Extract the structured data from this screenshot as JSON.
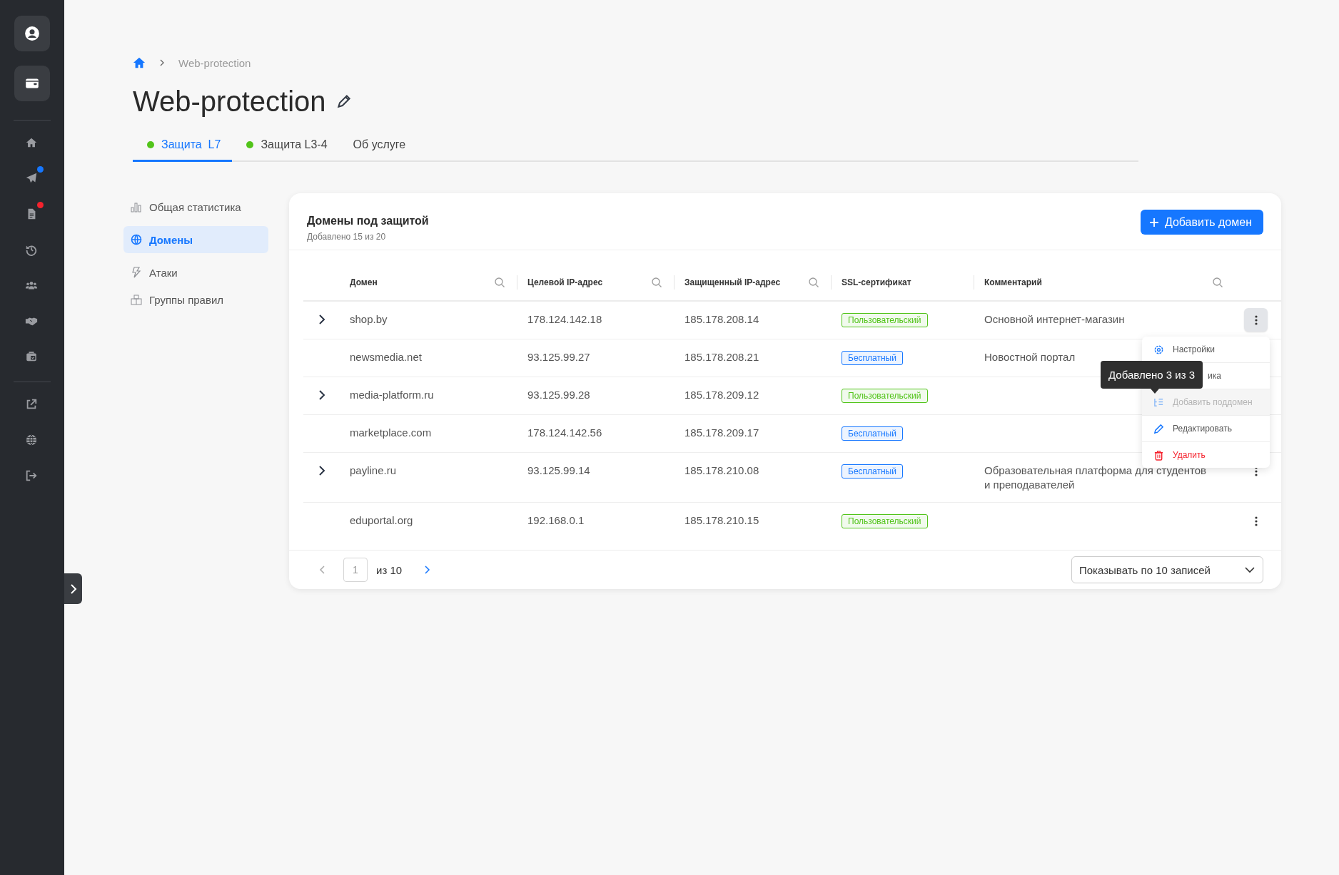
{
  "sidebar": {
    "top_items": [
      {
        "kind": "user"
      },
      {
        "kind": "wallet"
      }
    ],
    "items": [
      {
        "kind": "home"
      },
      {
        "kind": "plane",
        "color": "#1677ff"
      },
      {
        "kind": "doc",
        "color": "#f5222d"
      },
      {
        "kind": "history"
      },
      {
        "kind": "users"
      },
      {
        "kind": "handshake"
      },
      {
        "kind": "bag"
      }
    ],
    "bottom_items": [
      {
        "kind": "external"
      },
      {
        "kind": "globe"
      },
      {
        "kind": "logout"
      }
    ]
  },
  "breadcrumb": {
    "current": "Web-protection"
  },
  "title": "Web-protection",
  "tabs": [
    {
      "label": "Защита  L7",
      "selected": true,
      "dot": true
    },
    {
      "label": "Защита L3-4",
      "selected": false,
      "dot": true
    },
    {
      "label": "Об услуге",
      "selected": false,
      "dot": false
    }
  ],
  "nav": [
    {
      "label": "Общая статистика",
      "kind": "chart",
      "selected": false
    },
    {
      "label": "Домены",
      "kind": "globe",
      "selected": true
    },
    {
      "label": "Атаки",
      "kind": "bolt",
      "selected": false
    },
    {
      "label": "Группы правил",
      "kind": "rules",
      "selected": false
    }
  ],
  "card": {
    "title": "Домены под защитой",
    "subtitle": "Добавлено 15 из 20",
    "add_button": "Добавить домен"
  },
  "table": {
    "columns": [
      {
        "label": "Домен",
        "searchable": true
      },
      {
        "label": "Целевой IP-адрес",
        "searchable": true
      },
      {
        "label": "Защищенный IP-адрес",
        "searchable": true
      },
      {
        "label": "SSL-сертификат",
        "searchable": false
      },
      {
        "label": "Комментарий",
        "searchable": true
      }
    ],
    "rows": [
      {
        "expandable": true,
        "domain": "shop.by",
        "target_ip": "178.124.142.18",
        "protected_ip": "185.178.208.14",
        "ssl": {
          "label": "Пользовательский",
          "color": "#52c41a"
        },
        "comment": "Основной интернет-магазин",
        "actions_button": true,
        "menu_open": true
      },
      {
        "expandable": false,
        "domain": "newsmedia.net",
        "target_ip": "93.125.99.27",
        "protected_ip": "185.178.208.21",
        "ssl": {
          "label": "Бесплатный",
          "color": "#1677ff"
        },
        "comment": "Новостной портал",
        "actions_button": false
      },
      {
        "expandable": true,
        "domain": "media-platform.ru",
        "target_ip": "93.125.99.28",
        "protected_ip": "185.178.209.12",
        "ssl": {
          "label": "Пользовательский",
          "color": "#52c41a"
        },
        "actions_button": false
      },
      {
        "expandable": false,
        "domain": "marketplace.com",
        "target_ip": "178.124.142.56",
        "protected_ip": "185.178.209.17",
        "ssl": {
          "label": "Бесплатный",
          "color": "#1677ff"
        },
        "actions_button": false
      },
      {
        "expandable": true,
        "domain": "payline.ru",
        "target_ip": "93.125.99.14",
        "protected_ip": "185.178.210.08",
        "ssl": {
          "label": "Бесплатный",
          "color": "#1677ff"
        },
        "comment": "Образовательная платформа для студентов и преподавателей",
        "actions_button": true,
        "menu_open": false
      },
      {
        "expandable": false,
        "domain": "eduportal.org",
        "target_ip": "192.168.0.1",
        "protected_ip": "185.178.210.15",
        "ssl": {
          "label": "Пользовательский",
          "color": "#52c41a"
        },
        "actions_button": true,
        "menu_open": false
      }
    ]
  },
  "menu": {
    "items": [
      {
        "label": "Настройки",
        "kind": "gear",
        "disabled": false,
        "danger": false
      },
      {
        "label": "ика",
        "kind": "covered",
        "disabled": false,
        "danger": false
      },
      {
        "label": "Добавить поддомен",
        "kind": "subdomain",
        "disabled": true,
        "danger": false
      },
      {
        "label": "Редактировать",
        "kind": "pencil",
        "disabled": false,
        "danger": false
      },
      {
        "label": "Удалить",
        "kind": "trash",
        "disabled": false,
        "danger": true
      }
    ],
    "tooltip": "Добавлено 3 из 3"
  },
  "pagination": {
    "page": "1",
    "of": "из 10",
    "page_size": "Показывать по 10 записей"
  }
}
